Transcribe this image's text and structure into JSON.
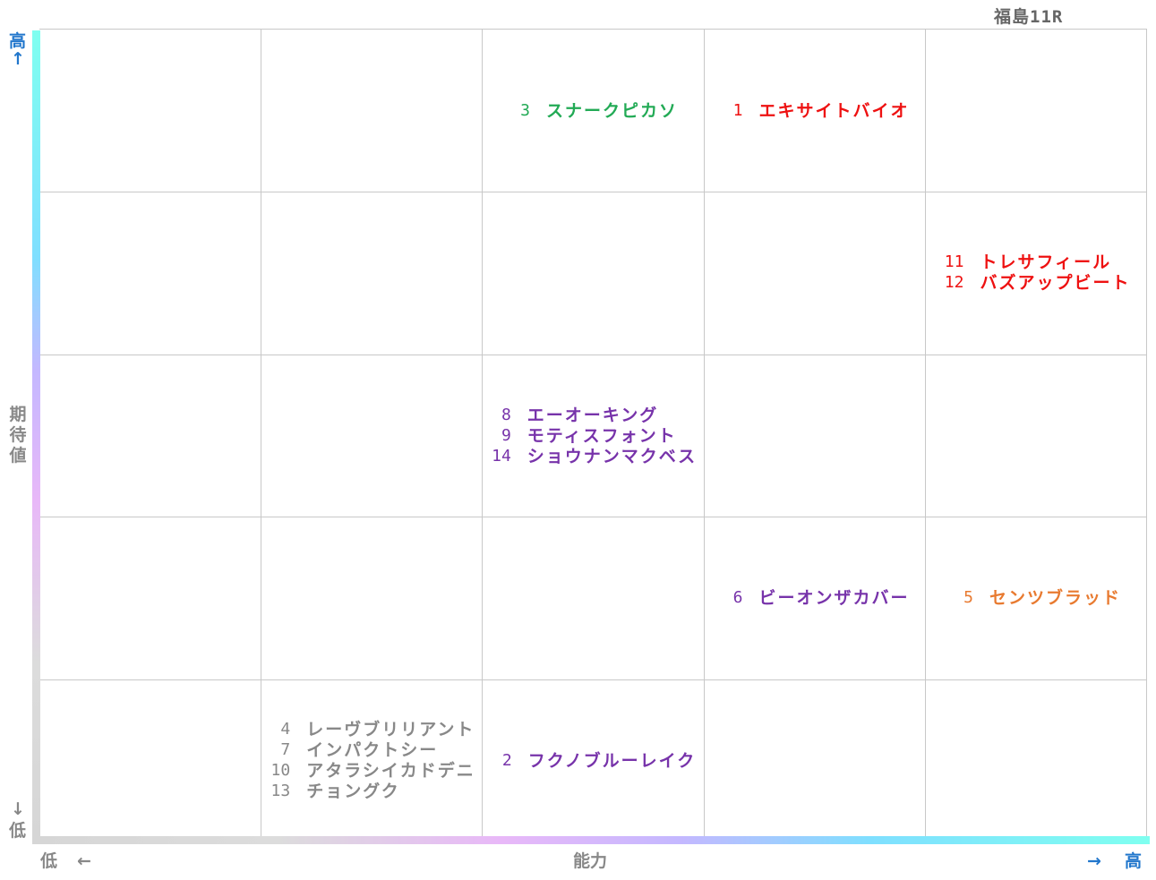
{
  "title": "福島11R",
  "axes": {
    "x_title": "能力",
    "y_title_chars": [
      "期",
      "待",
      "値"
    ],
    "high": "高",
    "low": "低",
    "arrow_up": "↑",
    "arrow_down": "↓",
    "arrow_left": "←",
    "arrow_right": "→"
  },
  "colors": {
    "red": "#ee1111",
    "green": "#22aa55",
    "purple": "#7733aa",
    "orange": "#e87a30",
    "gray": "#888888",
    "axis_high": "#2277cc",
    "axis_low": "#888888"
  },
  "chart_data": {
    "type": "table",
    "xlabel": "能力",
    "ylabel": "期待値",
    "columns": 5,
    "rows": 5,
    "cells": [
      {
        "ability": 3,
        "expectation": 5,
        "color": "#22aa55",
        "entries": [
          {
            "num": "3",
            "name": "スナークピカソ"
          }
        ]
      },
      {
        "ability": 4,
        "expectation": 5,
        "color": "#ee1111",
        "entries": [
          {
            "num": "1",
            "name": "エキサイトバイオ"
          }
        ]
      },
      {
        "ability": 5,
        "expectation": 4,
        "color": "#ee1111",
        "entries": [
          {
            "num": "11",
            "name": "トレサフィール"
          },
          {
            "num": "12",
            "name": "バズアップビート"
          }
        ]
      },
      {
        "ability": 3,
        "expectation": 3,
        "color": "#7733aa",
        "entries": [
          {
            "num": "8",
            "name": "エーオーキング"
          },
          {
            "num": "9",
            "name": "モティスフォント"
          },
          {
            "num": "14",
            "name": "ショウナンマクベス"
          }
        ]
      },
      {
        "ability": 4,
        "expectation": 2,
        "color": "#7733aa",
        "entries": [
          {
            "num": "6",
            "name": "ビーオンザカバー"
          }
        ]
      },
      {
        "ability": 5,
        "expectation": 2,
        "color": "#e87a30",
        "entries": [
          {
            "num": "5",
            "name": "センツブラッド"
          }
        ]
      },
      {
        "ability": 2,
        "expectation": 1,
        "color": "#888888",
        "entries": [
          {
            "num": "4",
            "name": "レーヴブリリアント"
          },
          {
            "num": "7",
            "name": "インパクトシー"
          },
          {
            "num": "10",
            "name": "アタラシイカドデニ"
          },
          {
            "num": "13",
            "name": "チョングク"
          }
        ]
      },
      {
        "ability": 3,
        "expectation": 1,
        "color": "#7733aa",
        "entries": [
          {
            "num": "2",
            "name": "フクノブルーレイク"
          }
        ]
      }
    ]
  }
}
